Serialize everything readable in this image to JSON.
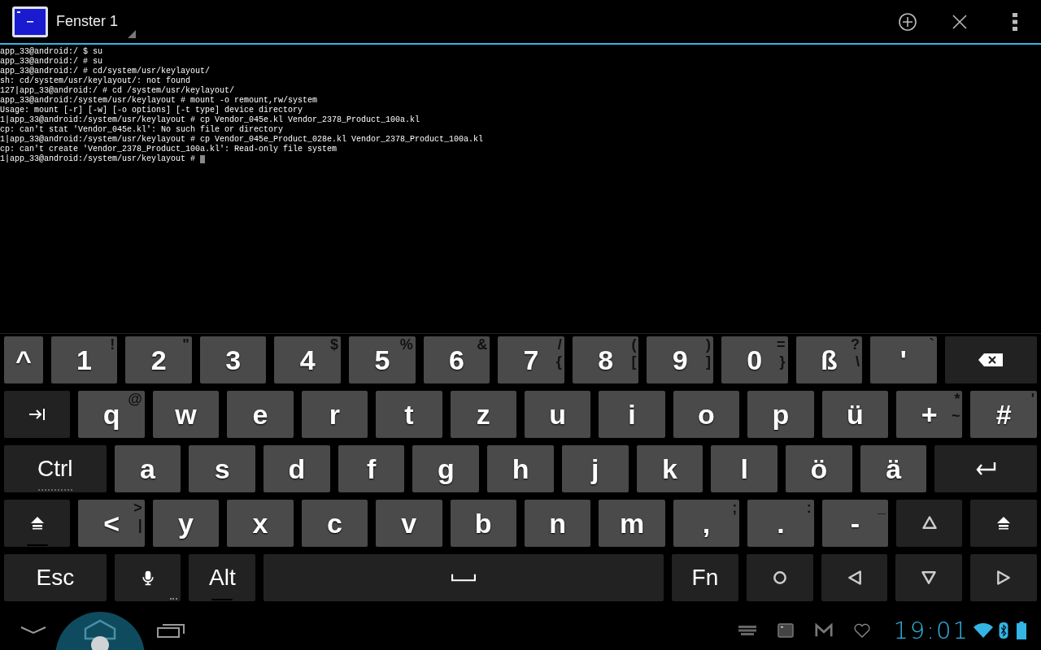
{
  "title_bar": {
    "title": "Fenster 1"
  },
  "terminal": {
    "lines": [
      "app_33@android:/ $ su",
      "app_33@android:/ # su",
      "app_33@android:/ # cd/system/usr/keylayout/",
      "sh: cd/system/usr/keylayout/: not found",
      "127|app_33@android:/ # cd /system/usr/keylayout/",
      "app_33@android:/system/usr/keylayout # mount -o remount,rw/system",
      "Usage: mount [-r] [-w] [-o options] [-t type] device directory",
      "1|app_33@android:/system/usr/keylayout # cp Vendor_045e.kl Vendor_2378_Product_100a.kl",
      "cp: can't stat 'Vendor_045e.kl': No such file or directory",
      "1|app_33@android:/system/usr/keylayout # cp Vendor_045e_Product_028e.kl Vendor_2378_Product_100a.kl",
      "cp: can't create 'Vendor_2378_Product_100a.kl': Read-only file system",
      "1|app_33@android:/system/usr/keylayout # "
    ],
    "cursor": true
  },
  "keyboard": {
    "rows": [
      [
        {
          "kind": "char",
          "label": "^"
        },
        {
          "kind": "char",
          "label": "1",
          "top": "!"
        },
        {
          "kind": "char",
          "label": "2",
          "top": "\""
        },
        {
          "kind": "char",
          "label": "3"
        },
        {
          "kind": "char",
          "label": "4",
          "top": "$"
        },
        {
          "kind": "char",
          "label": "5",
          "top": "%"
        },
        {
          "kind": "char",
          "label": "6",
          "top": "&"
        },
        {
          "kind": "char",
          "label": "7",
          "top": "/",
          "bottom": "{"
        },
        {
          "kind": "char",
          "label": "8",
          "top": "(",
          "bottom": "["
        },
        {
          "kind": "char",
          "label": "9",
          "top": ")",
          "bottom": "]"
        },
        {
          "kind": "char",
          "label": "0",
          "top": "=",
          "bottom": "}"
        },
        {
          "kind": "char",
          "label": "ß",
          "top": "?",
          "bottom": "\\"
        },
        {
          "kind": "char",
          "label": "'",
          "top": "`"
        },
        {
          "kind": "backspace"
        }
      ],
      [
        {
          "kind": "tab"
        },
        {
          "kind": "char",
          "label": "q",
          "top": "@"
        },
        {
          "kind": "char",
          "label": "w"
        },
        {
          "kind": "char",
          "label": "e"
        },
        {
          "kind": "char",
          "label": "r"
        },
        {
          "kind": "char",
          "label": "t"
        },
        {
          "kind": "char",
          "label": "z"
        },
        {
          "kind": "char",
          "label": "u"
        },
        {
          "kind": "char",
          "label": "i"
        },
        {
          "kind": "char",
          "label": "o"
        },
        {
          "kind": "char",
          "label": "p"
        },
        {
          "kind": "char",
          "label": "ü"
        },
        {
          "kind": "char",
          "label": "+",
          "top": "*",
          "bottom": "~"
        },
        {
          "kind": "char",
          "label": "#",
          "top": "'"
        }
      ],
      [
        {
          "kind": "text",
          "label": "Ctrl",
          "underline": true,
          "dotted": true
        },
        {
          "kind": "char",
          "label": "a"
        },
        {
          "kind": "char",
          "label": "s"
        },
        {
          "kind": "char",
          "label": "d"
        },
        {
          "kind": "char",
          "label": "f"
        },
        {
          "kind": "char",
          "label": "g"
        },
        {
          "kind": "char",
          "label": "h"
        },
        {
          "kind": "char",
          "label": "j"
        },
        {
          "kind": "char",
          "label": "k"
        },
        {
          "kind": "char",
          "label": "l"
        },
        {
          "kind": "char",
          "label": "ö"
        },
        {
          "kind": "char",
          "label": "ä"
        },
        {
          "kind": "enter"
        }
      ],
      [
        {
          "kind": "shift",
          "underline": true,
          "dotted": false
        },
        {
          "kind": "char",
          "label": "<",
          "top": ">",
          "bottom": "|"
        },
        {
          "kind": "char",
          "label": "y"
        },
        {
          "kind": "char",
          "label": "x"
        },
        {
          "kind": "char",
          "label": "c"
        },
        {
          "kind": "char",
          "label": "v"
        },
        {
          "kind": "char",
          "label": "b"
        },
        {
          "kind": "char",
          "label": "n"
        },
        {
          "kind": "char",
          "label": "m"
        },
        {
          "kind": "char",
          "label": ",",
          "top": ";"
        },
        {
          "kind": "char",
          "label": ".",
          "top": ":"
        },
        {
          "kind": "char",
          "label": "-",
          "top": "_"
        },
        {
          "kind": "up"
        },
        {
          "kind": "shift"
        }
      ],
      [
        {
          "kind": "text",
          "label": "Esc"
        },
        {
          "kind": "mic",
          "more": true
        },
        {
          "kind": "text",
          "label": "Alt",
          "underline": true,
          "dotted": false
        },
        {
          "kind": "space"
        },
        {
          "kind": "text",
          "label": "Fn"
        },
        {
          "kind": "circle"
        },
        {
          "kind": "left"
        },
        {
          "kind": "down"
        },
        {
          "kind": "right"
        }
      ]
    ]
  },
  "status_bar": {
    "time": "19:01"
  }
}
